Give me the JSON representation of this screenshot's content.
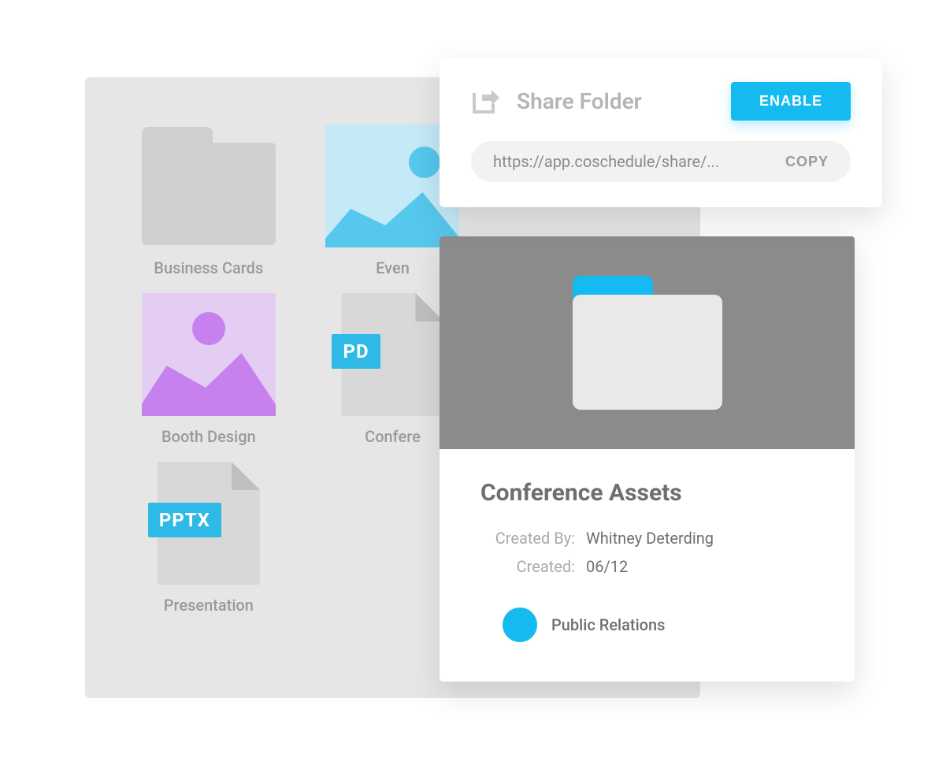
{
  "grid": {
    "items": [
      {
        "label": "Business Cards",
        "type": "folder"
      },
      {
        "label": "Even",
        "type": "image-blue"
      },
      {
        "label": "",
        "type": "hidden"
      },
      {
        "label": "Booth Design",
        "type": "image-purple"
      },
      {
        "label": "Confere",
        "type": "pdf",
        "badge": "PD"
      },
      {
        "label": "",
        "type": "hidden"
      },
      {
        "label": "Presentation",
        "type": "pptx",
        "badge": "PPTX"
      }
    ]
  },
  "share": {
    "title": "Share Folder",
    "enable": "ENABLE",
    "url": "https://app.coschedule/share/...",
    "copy": "COPY"
  },
  "details": {
    "title": "Conference Assets",
    "created_by_label": "Created By:",
    "created_by": "Whitney Deterding",
    "created_label": "Created:",
    "created": "06/12",
    "tag": "Public Relations"
  }
}
